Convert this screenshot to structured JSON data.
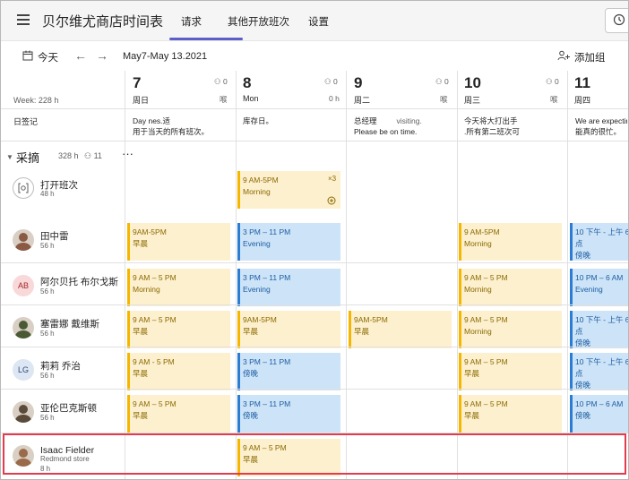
{
  "header": {
    "title": "贝尔维尤商店时间表",
    "tabs": [
      "请求",
      "其他开放班次",
      "设置"
    ]
  },
  "toolbar": {
    "today_label": "今天",
    "date_range": "May7-May 13.2021",
    "add_group_label": "添加组"
  },
  "week_hours": "Week: 228 h",
  "note_label": "日签记",
  "days": [
    {
      "num": "7",
      "name": "周日",
      "stats": "0",
      "hours": "喉"
    },
    {
      "num": "8",
      "name": "Mon",
      "stats": "0",
      "hours": "0 h"
    },
    {
      "num": "9",
      "name": "周二",
      "stats": "0",
      "hours": "喉"
    },
    {
      "num": "10",
      "name": "周三",
      "stats": "0",
      "hours": "喉"
    },
    {
      "num": "11",
      "name": "周四",
      "stats": "",
      "hours": ""
    }
  ],
  "notes": [
    {
      "line1": "Day nes.适",
      "line2": "用于当天的所有班次。"
    },
    {
      "line1": "库存日。",
      "line2": ""
    },
    {
      "line1": "总经理",
      "line1b": "visiting.",
      "line2": "Please be on time."
    },
    {
      "line1": "今天将大打出手",
      "line2": ".所有第二班次可"
    },
    {
      "line1": "We are expecting",
      "line2": "能真的很忙。"
    }
  ],
  "group": {
    "name": "采摘",
    "hours": "328 h",
    "members": "11",
    "more": "···"
  },
  "open_shifts": {
    "label": "打开班次",
    "hours": "48 h",
    "shift": {
      "time": "9 AM-5PM",
      "label": "Morning",
      "count": "×3"
    }
  },
  "people": [
    {
      "name": "田中雷",
      "hours": "56 h",
      "avatar": "photo",
      "shifts": [
        {
          "day": 0,
          "color": "y",
          "time": "9AM-5PM",
          "label": "早晨"
        },
        {
          "day": 1,
          "color": "b",
          "time": "3 PM – 11 PM",
          "label": "Evening"
        },
        {
          "day": 3,
          "color": "y",
          "time": "9 AM-5PM",
          "label": "Morning"
        },
        {
          "day": 4,
          "color": "b",
          "time": "10 下午 - 上午 6 点",
          "label": "傍晚"
        }
      ]
    },
    {
      "name": "阿尔贝托 布尔戈斯",
      "hours": "56 h",
      "avatar": "AB",
      "shifts": [
        {
          "day": 0,
          "color": "y",
          "time": "9 AM – 5 PM",
          "label": "Morning"
        },
        {
          "day": 1,
          "color": "b",
          "time": "3 PM – 11 PM",
          "label": "Evening"
        },
        {
          "day": 3,
          "color": "y",
          "time": "9 AM – 5 PM",
          "label": "Morning"
        },
        {
          "day": 4,
          "color": "b",
          "time": "10 PM – 6 AM",
          "label": "Evening"
        }
      ]
    },
    {
      "name": "塞雷娜 戴维斯",
      "hours": "56 h",
      "avatar": "photo",
      "shifts": [
        {
          "day": 0,
          "color": "y",
          "time": "9 AM – 5 PM",
          "label": "早晨"
        },
        {
          "day": 1,
          "color": "y",
          "time": "9AM-5PM",
          "label": "早晨"
        },
        {
          "day": 2,
          "color": "y",
          "time": "9AM-5PM",
          "label": "早晨"
        },
        {
          "day": 3,
          "color": "y",
          "time": "9 AM – 5 PM",
          "label": "Morning"
        },
        {
          "day": 4,
          "color": "b",
          "time": "10 下午 - 上午 6 点",
          "label": "傍晚"
        }
      ]
    },
    {
      "name": "莉莉 乔治",
      "hours": "56 h",
      "avatar": "LG",
      "shifts": [
        {
          "day": 0,
          "color": "y",
          "time": "9 AM - 5 PM",
          "label": "早晨"
        },
        {
          "day": 1,
          "color": "b",
          "time": "3 PM – 11 PM",
          "label": "傍晚"
        },
        {
          "day": 3,
          "color": "y",
          "time": "9 AM – 5 PM",
          "label": "早晨"
        },
        {
          "day": 4,
          "color": "b",
          "time": "10 下午 - 上午 6 点",
          "label": "傍晚"
        }
      ]
    },
    {
      "name": "亚伦巴克斯顿",
      "hours": "56 h",
      "avatar": "photo",
      "shifts": [
        {
          "day": 0,
          "color": "y",
          "time": "9 AM – 5 PM",
          "label": "早晨"
        },
        {
          "day": 1,
          "color": "b",
          "time": "3 PM – 11 PM",
          "label": "傍晚"
        },
        {
          "day": 3,
          "color": "y",
          "time": "9 AM – 5 PM",
          "label": "早晨"
        },
        {
          "day": 4,
          "color": "b",
          "time": "10 PM – 6 AM",
          "label": "傍晚"
        }
      ]
    },
    {
      "name": "Isaac Fielder",
      "sub": "Redmond store",
      "hours": "8 h",
      "avatar": "photo",
      "shifts": [
        {
          "day": 1,
          "color": "y",
          "time": "9 AM – 5 PM",
          "label": "早晨"
        }
      ]
    }
  ],
  "colors": {
    "accent": "#5b5fc7",
    "morning": "#f6b600",
    "evening": "#2d7cd3",
    "highlight": "#e23b4e"
  }
}
